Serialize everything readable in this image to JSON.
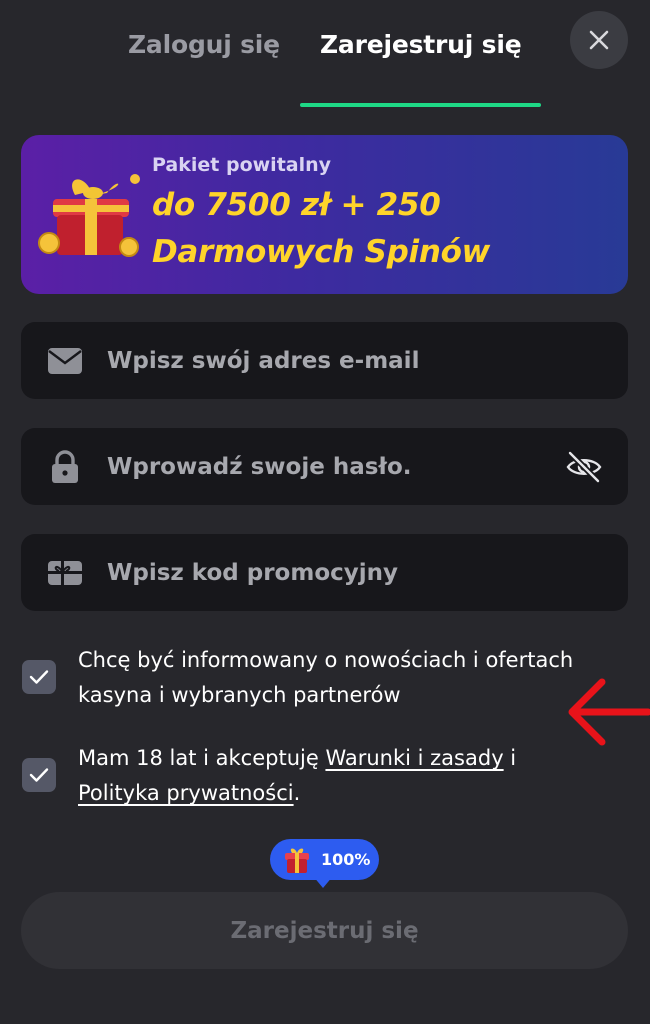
{
  "tabs": {
    "login_label": "Zaloguj się",
    "register_label": "Zarejestruj się",
    "active": "register"
  },
  "promo": {
    "label": "Pakiet powitalny",
    "line1": "do 7500 zł + 250",
    "line2": "Darmowych Spinów"
  },
  "form": {
    "email_placeholder": "Wpisz swój adres e-mail",
    "password_placeholder": "Wprowadź swoje hasło.",
    "promo_placeholder": "Wpisz kod promocyjny",
    "email_value": "",
    "password_value": "",
    "promo_value": ""
  },
  "consents": {
    "marketing_text": "Chcę być informowany o nowościach i ofertach kasyna i wybranych partnerów",
    "marketing_checked": true,
    "terms_prefix": "Mam 18 lat i akceptuję ",
    "terms_link": "Warunki i zasady",
    "terms_mid": " i ",
    "privacy_link": "Polityka prywatności",
    "terms_suffix": ".",
    "terms_checked": true
  },
  "badge": {
    "text": "100%"
  },
  "submit_label": "Zarejestruj się",
  "colors": {
    "background": "#27272c",
    "field": "#17171b",
    "accent_tab": "#1ed886",
    "promo_text": "#ffd42a",
    "badge": "#2d5cf0",
    "arrow": "#e8131a",
    "checkbox": "#555867"
  },
  "icons": {
    "close": "close-icon",
    "email": "envelope-icon",
    "password": "lock-icon",
    "promo": "gift-card-icon",
    "visibility": "eye-off-icon",
    "checkbox": "checkmark-icon",
    "badge": "gift-icon"
  }
}
